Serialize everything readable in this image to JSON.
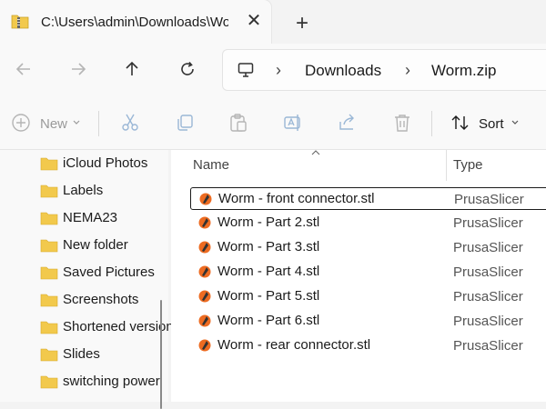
{
  "window": {
    "tab_title": "C:\\Users\\admin\\Downloads\\Worm.zip",
    "close_glyph": "✕",
    "new_tab_glyph": "+"
  },
  "nav": {
    "back_icon": "arrow-left-icon",
    "forward_icon": "arrow-right-icon",
    "up_icon": "arrow-up-icon",
    "refresh_icon": "refresh-icon"
  },
  "address": {
    "separator": "›",
    "crumbs": [
      "Downloads",
      "Worm.zip"
    ]
  },
  "toolbar": {
    "new_label": "New",
    "sort_label": "Sort"
  },
  "sidebar": {
    "items": [
      {
        "label": "iCloud Photos"
      },
      {
        "label": "Labels"
      },
      {
        "label": "NEMA23"
      },
      {
        "label": "New folder"
      },
      {
        "label": "Saved Pictures"
      },
      {
        "label": "Screenshots"
      },
      {
        "label": "Shortened versions"
      },
      {
        "label": "Slides"
      },
      {
        "label": "switching power"
      }
    ]
  },
  "columns": {
    "name": "Name",
    "type": "Type"
  },
  "files": [
    {
      "name": "Worm - front connector.stl",
      "type": "PrusaSlicer"
    },
    {
      "name": "Worm - Part 2.stl",
      "type": "PrusaSlicer"
    },
    {
      "name": "Worm - Part 3.stl",
      "type": "PrusaSlicer"
    },
    {
      "name": "Worm - Part 4.stl",
      "type": "PrusaSlicer"
    },
    {
      "name": "Worm - Part 5.stl",
      "type": "PrusaSlicer"
    },
    {
      "name": "Worm - Part 6.stl",
      "type": "PrusaSlicer"
    },
    {
      "name": "Worm - rear connector.stl",
      "type": "PrusaSlicer"
    }
  ],
  "colors": {
    "folder": "#f2c94c",
    "prusa_orange": "#ed6b21",
    "accent": "#1b1b1b"
  }
}
